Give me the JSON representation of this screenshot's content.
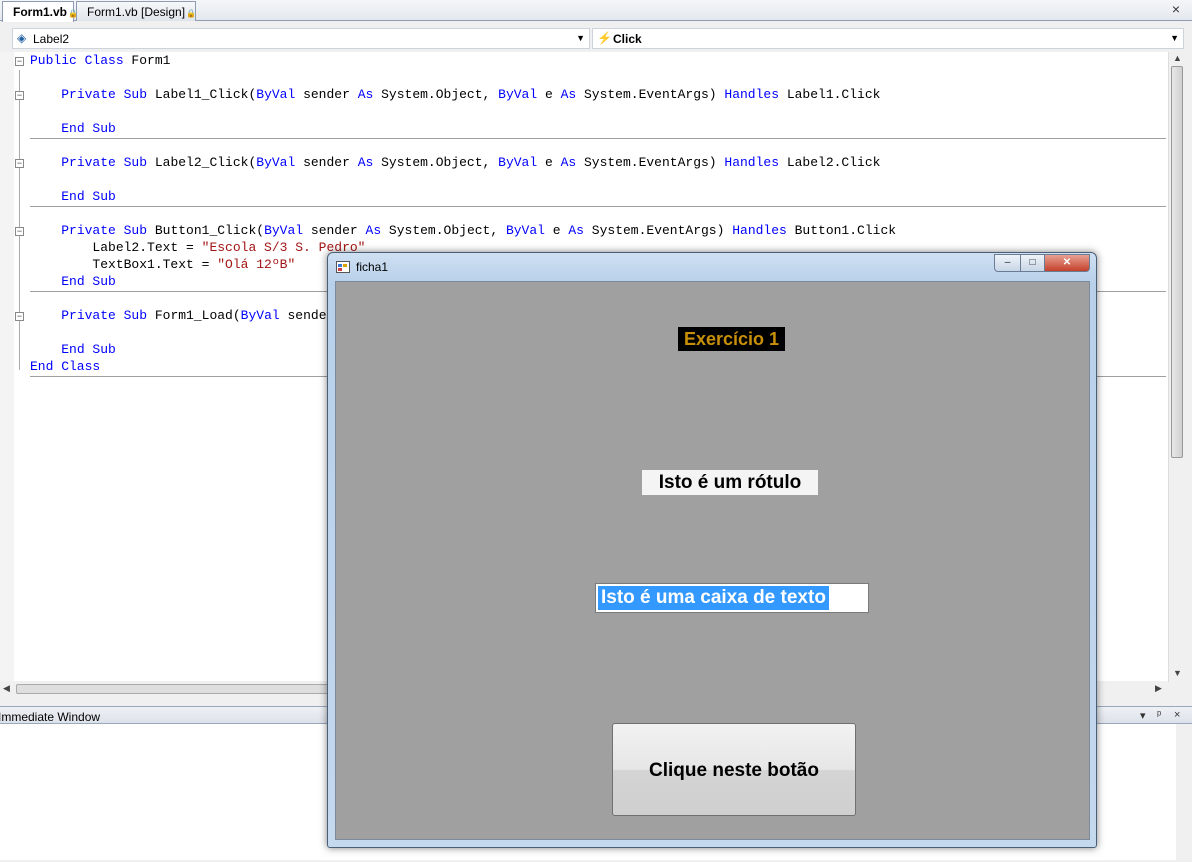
{
  "tabs": [
    {
      "label": "Form1.vb",
      "locked": true,
      "active": true
    },
    {
      "label": "Form1.vb [Design]",
      "locked": true,
      "active": false
    }
  ],
  "tab_close": "×",
  "dropdowns": {
    "object": "Label2",
    "event": "Click"
  },
  "code": {
    "lines": [
      {
        "row": 0,
        "parts": [
          [
            "kw",
            "Public Class"
          ],
          [
            "t",
            " Form1"
          ]
        ]
      },
      {
        "row": 2,
        "parts": [
          [
            "t",
            "    "
          ],
          [
            "kw",
            "Private Sub"
          ],
          [
            "t",
            " Label1_Click("
          ],
          [
            "kw",
            "ByVal"
          ],
          [
            "t",
            " sender "
          ],
          [
            "kw",
            "As"
          ],
          [
            "t",
            " System.Object, "
          ],
          [
            "kw",
            "ByVal"
          ],
          [
            "t",
            " e "
          ],
          [
            "kw",
            "As"
          ],
          [
            "t",
            " System.EventArgs) "
          ],
          [
            "kw",
            "Handles"
          ],
          [
            "t",
            " Label1.Click"
          ]
        ]
      },
      {
        "row": 4,
        "parts": [
          [
            "t",
            "    "
          ],
          [
            "kw",
            "End Sub"
          ]
        ]
      },
      {
        "row": 6,
        "parts": [
          [
            "t",
            "    "
          ],
          [
            "kw",
            "Private Sub"
          ],
          [
            "t",
            " Label2_Click("
          ],
          [
            "kw",
            "ByVal"
          ],
          [
            "t",
            " sender "
          ],
          [
            "kw",
            "As"
          ],
          [
            "t",
            " System.Object, "
          ],
          [
            "kw",
            "ByVal"
          ],
          [
            "t",
            " e "
          ],
          [
            "kw",
            "As"
          ],
          [
            "t",
            " System.EventArgs) "
          ],
          [
            "kw",
            "Handles"
          ],
          [
            "t",
            " Label2.Click"
          ]
        ]
      },
      {
        "row": 8,
        "parts": [
          [
            "t",
            "    "
          ],
          [
            "kw",
            "End Sub"
          ]
        ]
      },
      {
        "row": 10,
        "parts": [
          [
            "t",
            "    "
          ],
          [
            "kw",
            "Private Sub"
          ],
          [
            "t",
            " Button1_Click("
          ],
          [
            "kw",
            "ByVal"
          ],
          [
            "t",
            " sender "
          ],
          [
            "kw",
            "As"
          ],
          [
            "t",
            " System.Object, "
          ],
          [
            "kw",
            "ByVal"
          ],
          [
            "t",
            " e "
          ],
          [
            "kw",
            "As"
          ],
          [
            "t",
            " System.EventArgs) "
          ],
          [
            "kw",
            "Handles"
          ],
          [
            "t",
            " Button1.Click"
          ]
        ]
      },
      {
        "row": 11,
        "parts": [
          [
            "t",
            "        Label2.Text = "
          ],
          [
            "str",
            "\"Escola S/3 S. Pedro\""
          ]
        ]
      },
      {
        "row": 12,
        "parts": [
          [
            "t",
            "        TextBox1.Text = "
          ],
          [
            "str",
            "\"Olá 12ºB\""
          ]
        ]
      },
      {
        "row": 13,
        "parts": [
          [
            "t",
            "    "
          ],
          [
            "kw",
            "End Sub"
          ]
        ]
      },
      {
        "row": 15,
        "parts": [
          [
            "t",
            "    "
          ],
          [
            "kw",
            "Private Sub"
          ],
          [
            "t",
            " Form1_Load("
          ],
          [
            "kw",
            "ByVal"
          ],
          [
            "t",
            " sende"
          ]
        ]
      },
      {
        "row": 17,
        "parts": [
          [
            "t",
            "    "
          ],
          [
            "kw",
            "End Sub"
          ]
        ]
      },
      {
        "row": 18,
        "parts": [
          [
            "kw",
            "End Class"
          ]
        ]
      }
    ]
  },
  "immediate_window": {
    "title": "Immediate Window",
    "controls": [
      "▾",
      "ᵖ",
      "×"
    ]
  },
  "form_window": {
    "title": "ficha1",
    "controls": {
      "minimize": "–",
      "maximize": "□",
      "close": "✕"
    },
    "title_label": "Exercício 1",
    "label": "Isto é um rótulo",
    "textbox_value": "Isto é uma caixa de texto",
    "button": "Clique neste botão",
    "colors": {
      "form_bg": "#a0a0a0",
      "title_label_fg": "#c8900a",
      "title_label_bg": "#000000",
      "selection": "#3399ff"
    }
  }
}
